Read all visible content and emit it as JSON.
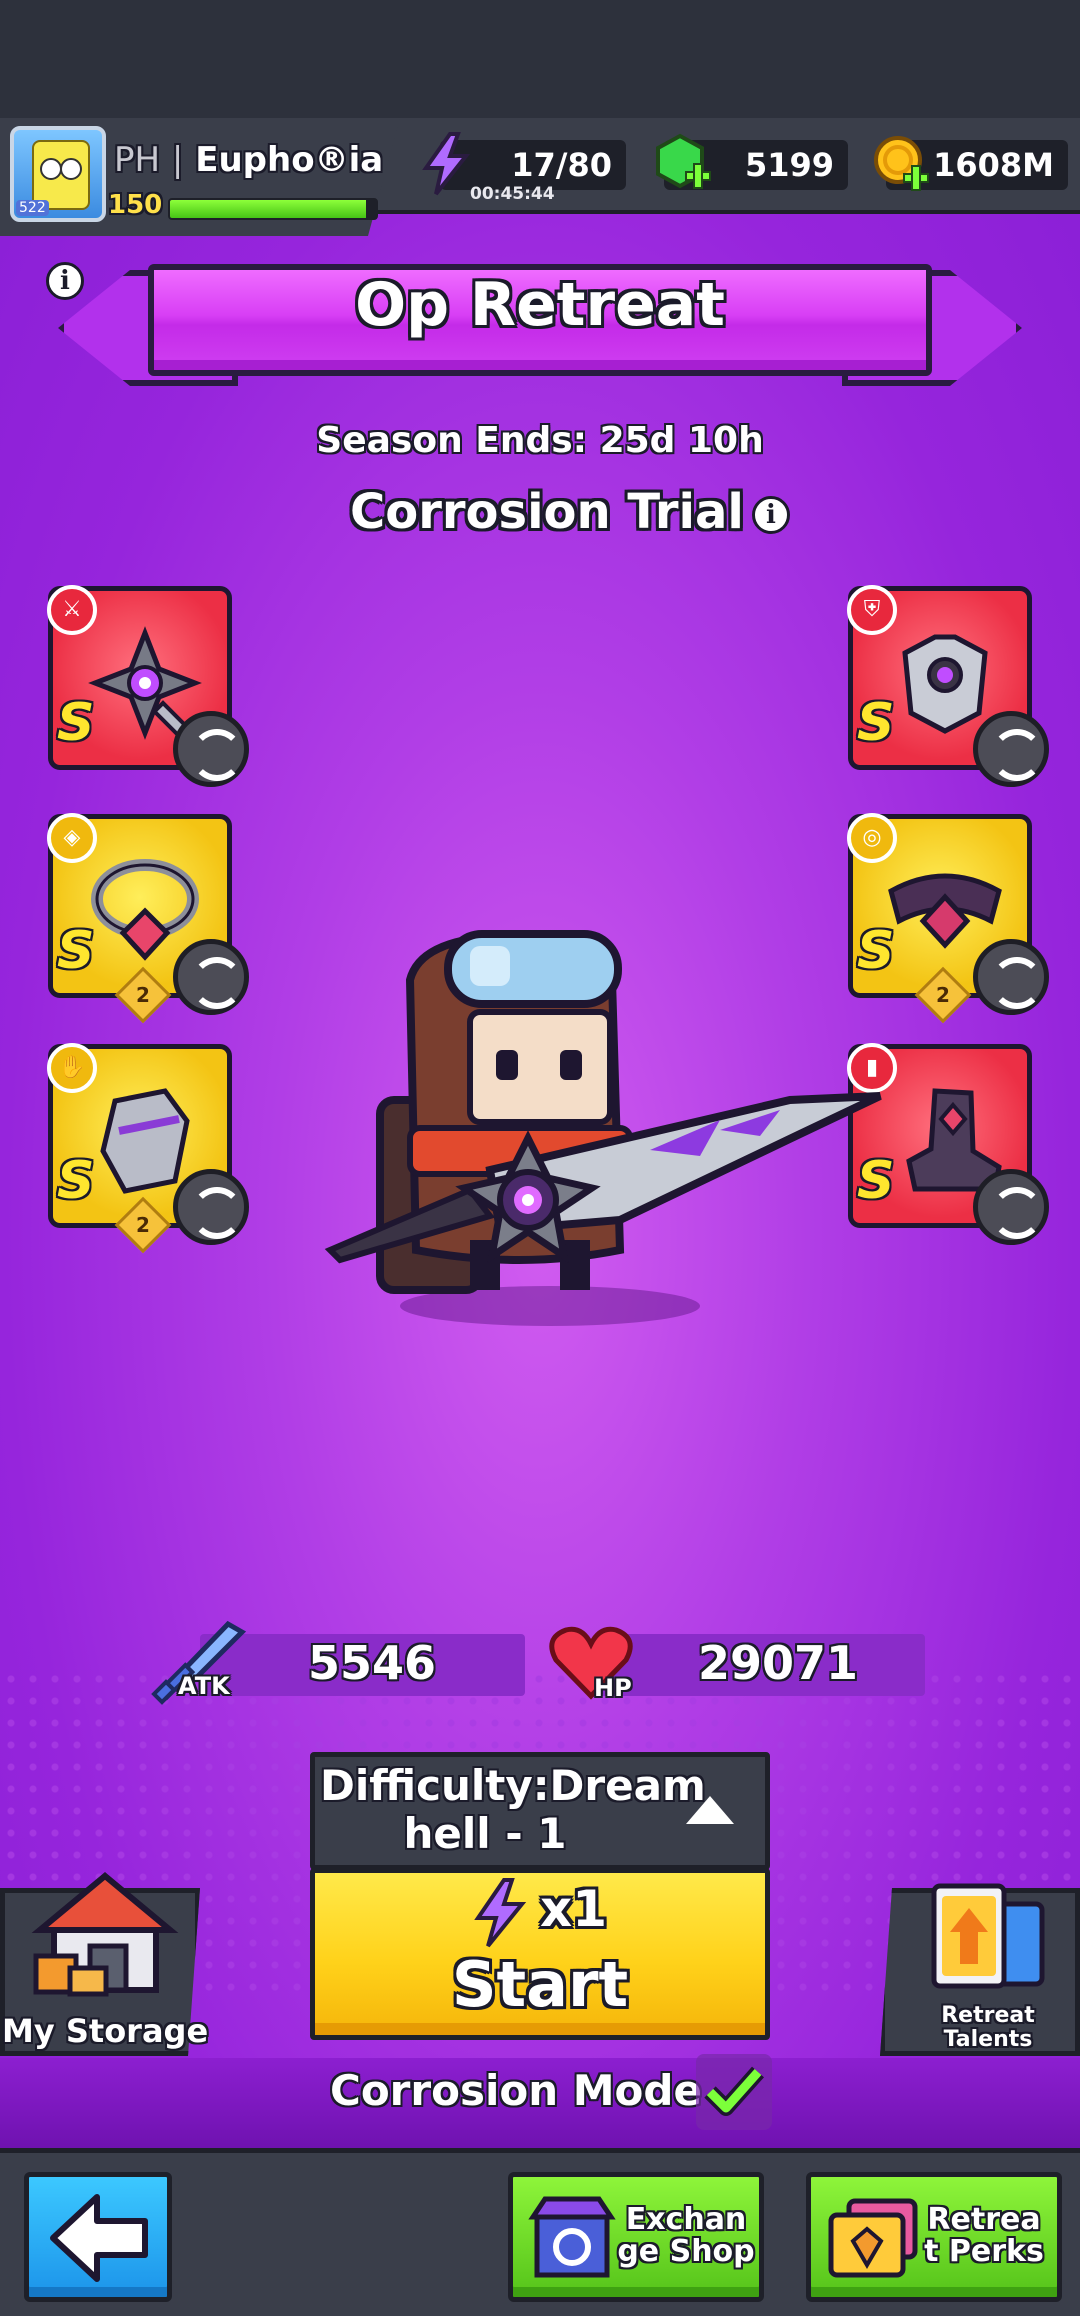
{
  "player": {
    "prefix": "PH",
    "separator": "|",
    "name": "Eupho®ia",
    "level": "150",
    "avatar_badge": "522",
    "xp_fraction": 0.95
  },
  "resources": {
    "energy": "17/80",
    "energy_timer": "00:45:44",
    "gems": "5199",
    "gold": "1608M"
  },
  "event": {
    "title": "Op Retreat",
    "season_ends": "Season Ends: 25d 10h",
    "mode_title": "Corrosion Trial"
  },
  "equipment": [
    {
      "slot": "weapon",
      "grade": "S",
      "rarity_color": "#ec2f45",
      "stars": null,
      "type_icon": "sword-icon"
    },
    {
      "slot": "armor",
      "grade": "S",
      "rarity_color": "#ec2f45",
      "stars": null,
      "type_icon": "armor-icon"
    },
    {
      "slot": "necklace",
      "grade": "S",
      "rarity_color": "#f3c414",
      "stars": "2",
      "type_icon": "necklace-icon"
    },
    {
      "slot": "belt",
      "grade": "S",
      "rarity_color": "#f3c414",
      "stars": "2",
      "type_icon": "belt-icon"
    },
    {
      "slot": "gloves",
      "grade": "S",
      "rarity_color": "#f3c414",
      "stars": "2",
      "type_icon": "glove-icon"
    },
    {
      "slot": "boots",
      "grade": "S",
      "rarity_color": "#ec2f45",
      "stars": null,
      "type_icon": "boot-icon"
    }
  ],
  "stats": {
    "atk_label": "ATK",
    "atk": "5546",
    "hp_label": "HP",
    "hp": "29071"
  },
  "difficulty": {
    "line1": "Difficulty:Dream",
    "line2": "hell - 1"
  },
  "start": {
    "cost": "x1",
    "label": "Start"
  },
  "corrosion_mode": {
    "label": "Corrosion Mode",
    "enabled": true
  },
  "side_buttons": {
    "storage": "My Storage",
    "talents_line1": "Retreat",
    "talents_line2": "Talents"
  },
  "bottom_nav": {
    "exchange_line1": "Exchan",
    "exchange_line2": "ge Shop",
    "perks_line1": "Retrea",
    "perks_line2": "t Perks"
  },
  "colors": {
    "purple_bg": "#9625dc",
    "banner": "#d83ff5",
    "start_yellow": "#ffd21a",
    "green_button": "#55c31a",
    "back_blue": "#1c94ea"
  }
}
